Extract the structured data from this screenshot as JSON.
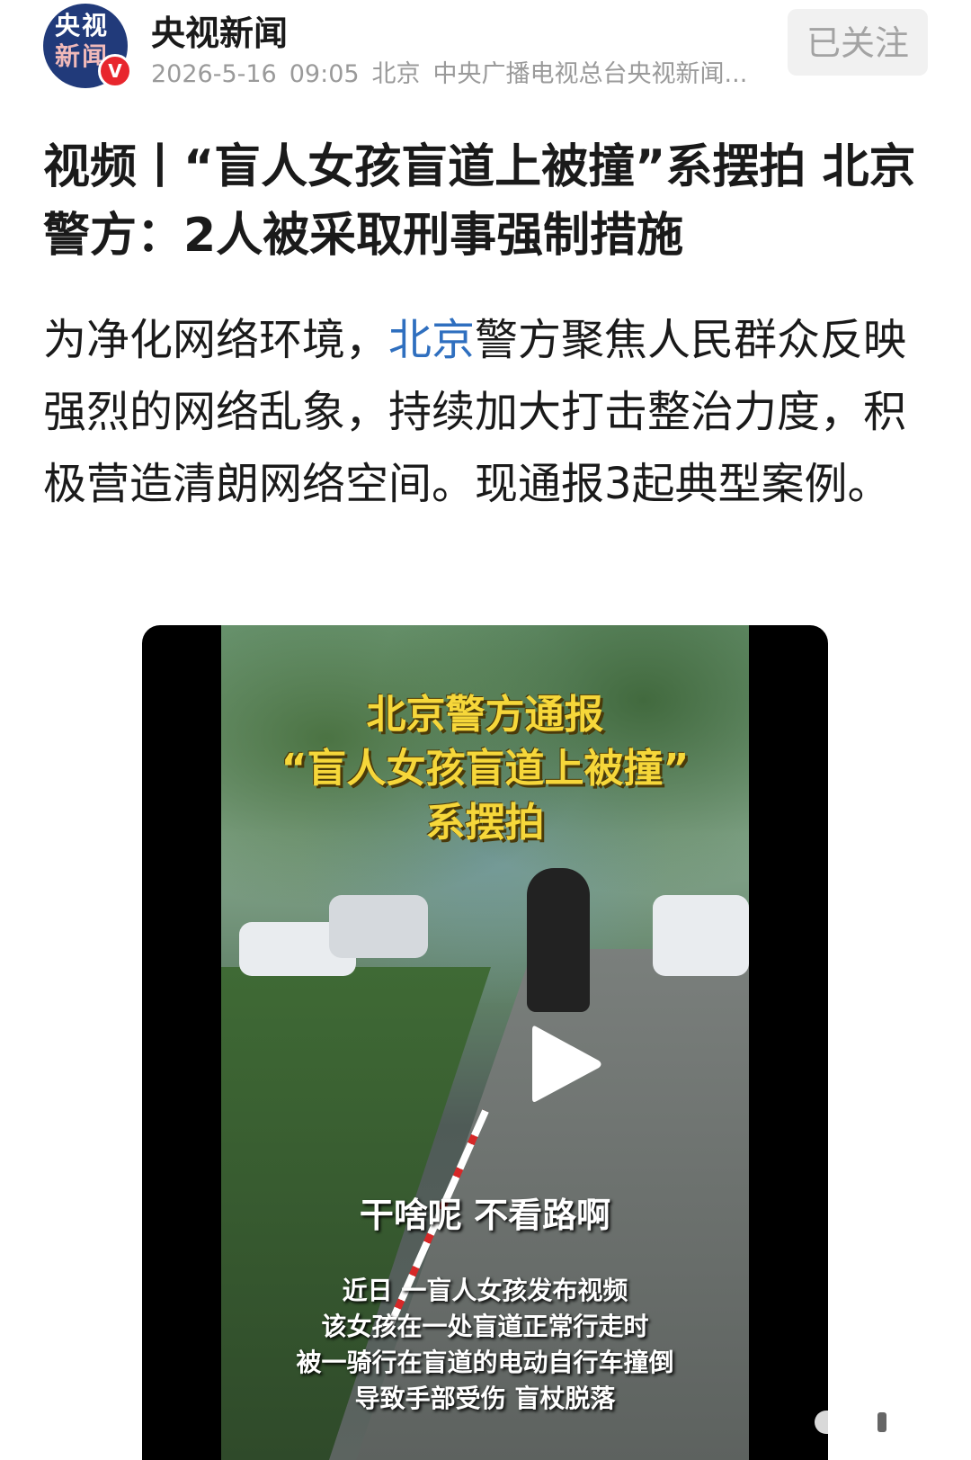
{
  "account": {
    "logo_line1": "央视",
    "logo_line2": "新闻",
    "verified_mark": "V",
    "name": "央视新闻",
    "date": "2026-5-16",
    "time": "09:05",
    "location": "北京",
    "source": "中央广播电视总台央视新闻...",
    "follow_label": "已关注"
  },
  "article": {
    "title": "视频丨“盲人女孩盲道上被撞”系摆拍 北京警方：2人被采取刑事强制措施",
    "body_before_link": "为净化网络环境，",
    "body_link": "北京",
    "body_after_link": "警方聚焦人民群众反映强烈的网络乱象，持续加大打击整治力度，积极营造清朗网络空间。现通报3起典型案例。"
  },
  "video": {
    "headline": [
      "北京警方通报",
      "“盲人女孩盲道上被撞”",
      "系摆拍"
    ],
    "caption_main": "干啥呢 不看路啊",
    "caption_lines": [
      "近日 一盲人女孩发布视频",
      "该女孩在一处盲道正常行走时",
      "被一骑行在盲道的电动自行车撞倒",
      "导致手部受伤 盲杖脱落"
    ],
    "play_icon": "play-icon"
  }
}
